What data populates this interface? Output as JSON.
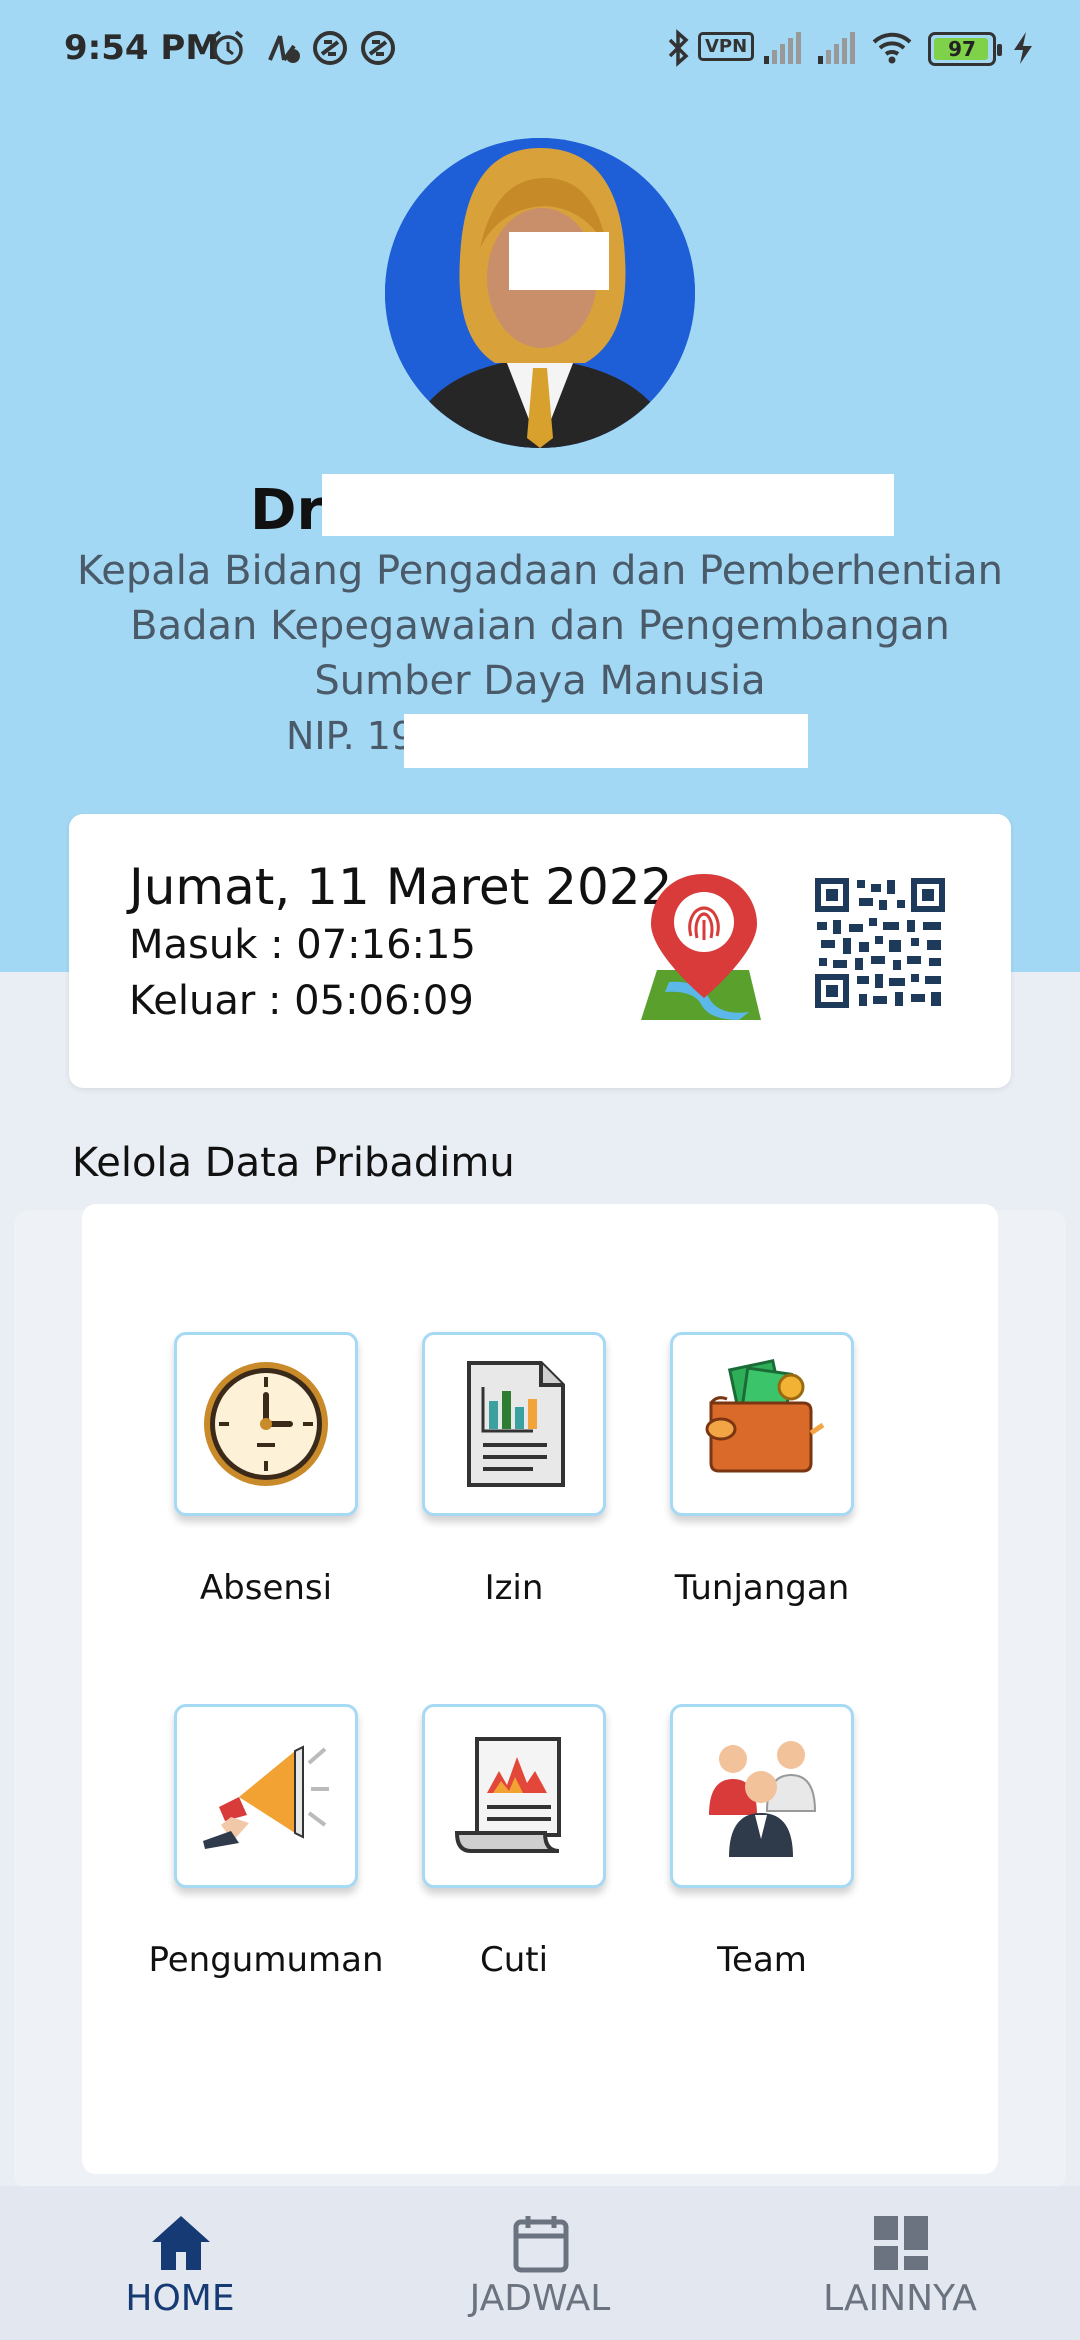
{
  "status_bar": {
    "time": "9:54 PM",
    "vpn_label": "VPN",
    "battery": "97",
    "icons": [
      "alarm-icon",
      "no-data-icon",
      "sync-icon",
      "sync-icon",
      "bluetooth-icon",
      "signal-icon",
      "signal-icon",
      "wifi-icon",
      "battery-icon",
      "charging-icon"
    ]
  },
  "profile": {
    "name_visible": "Dra",
    "position_line1": "Kepala Bidang Pengadaan dan Pemberhentian",
    "position_line2": "Badan Kepegawaian dan Pengembangan",
    "position_line3": "Sumber Daya Manusia",
    "nip_visible": "NIP. 19"
  },
  "attendance": {
    "date": "Jumat, 11 Maret 2022",
    "masuk": "Masuk : 07:16:15",
    "keluar": "Keluar : 05:06:09",
    "location_icon": "fingerprint-location-icon",
    "qr_icon": "qr-code-icon"
  },
  "section": {
    "title": "Kelola Data Pribadimu"
  },
  "menu": [
    {
      "label": "Absensi",
      "icon": "clock-icon"
    },
    {
      "label": "Izin",
      "icon": "report-document-icon"
    },
    {
      "label": "Tunjangan",
      "icon": "wallet-icon"
    },
    {
      "label": "Pengumuman",
      "icon": "megaphone-icon"
    },
    {
      "label": "Cuti",
      "icon": "chart-scroll-icon"
    },
    {
      "label": "Team",
      "icon": "team-icon"
    }
  ],
  "bottom_nav": [
    {
      "label": "HOME",
      "icon": "home-icon",
      "active": true
    },
    {
      "label": "JADWAL",
      "icon": "calendar-icon",
      "active": false
    },
    {
      "label": "LAINNYA",
      "icon": "grid-icon",
      "active": false
    }
  ],
  "colors": {
    "header_bg": "#a3d8f4",
    "page_bg": "#e9eef4",
    "tile_border": "#a6d9f4",
    "nav_active": "#163a73",
    "nav_inactive": "#6b7380"
  }
}
